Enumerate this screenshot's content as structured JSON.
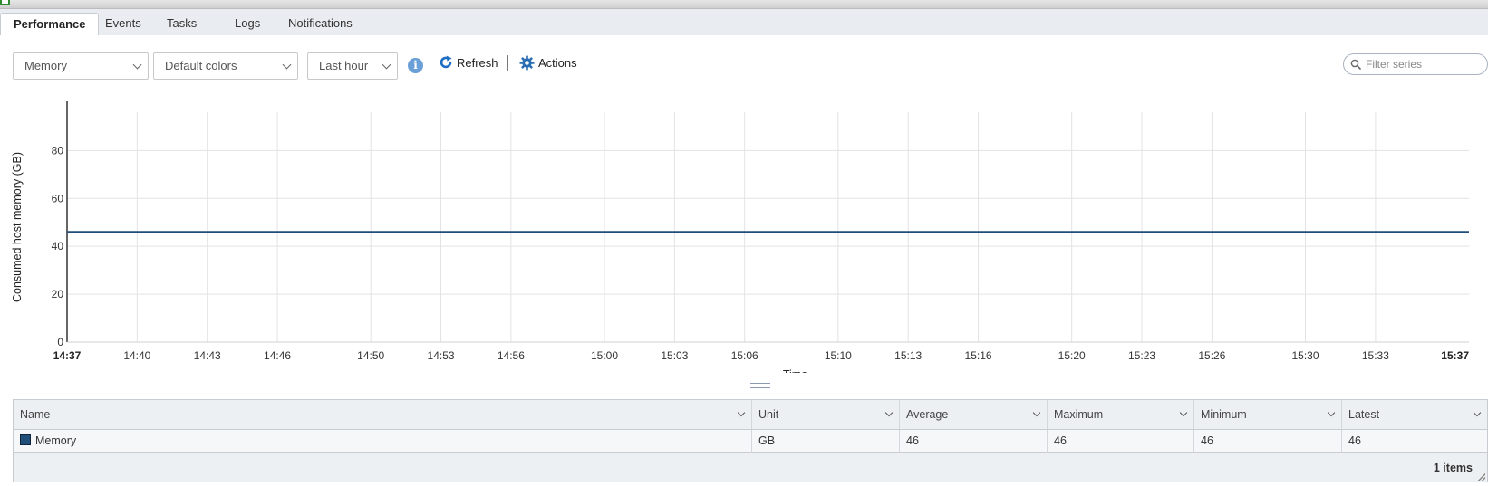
{
  "tabs": [
    {
      "label": "Performance",
      "active": true
    },
    {
      "label": "Events",
      "active": false
    },
    {
      "label": "Tasks",
      "active": false
    },
    {
      "label": "Logs",
      "active": false
    },
    {
      "label": "Notifications",
      "active": false
    }
  ],
  "toolbar": {
    "metric_select": "Memory",
    "color_select": "Default colors",
    "period_select": "Last hour",
    "info_icon": "info-icon",
    "refresh_label": "Refresh",
    "actions_label": "Actions",
    "filter_placeholder": "Filter series",
    "filter_value": ""
  },
  "colors": {
    "series_line": "#1f4e79",
    "accent": "#1e6fc4",
    "grid": "#e3e3e3"
  },
  "chart_data": {
    "type": "line",
    "title": "",
    "xlabel": "Time",
    "ylabel": "Consumed host memory (GB)",
    "ylim": [
      0,
      96
    ],
    "yticks": [
      0,
      20,
      40,
      60,
      80
    ],
    "x_start_label": "14:37",
    "x_end_label": "15:37",
    "xticks": [
      "14:40",
      "14:43",
      "14:46",
      "14:50",
      "14:53",
      "14:56",
      "15:00",
      "15:03",
      "15:06",
      "15:10",
      "15:13",
      "15:16",
      "15:20",
      "15:23",
      "15:26",
      "15:30",
      "15:33"
    ],
    "grid": true,
    "series": [
      {
        "name": "Memory",
        "x": [
          "14:37",
          "15:37"
        ],
        "values": [
          46,
          46
        ]
      }
    ]
  },
  "table": {
    "columns": [
      "Name",
      "Unit",
      "Average",
      "Maximum",
      "Minimum",
      "Latest"
    ],
    "rows": [
      {
        "name": "Memory",
        "unit": "GB",
        "average": "46",
        "maximum": "46",
        "minimum": "46",
        "latest": "46"
      }
    ],
    "item_count": "1 items"
  }
}
